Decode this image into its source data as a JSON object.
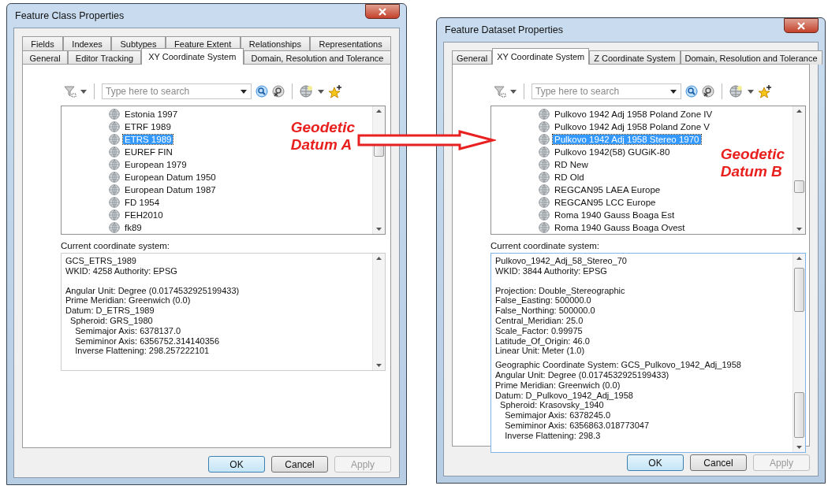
{
  "dialogs": [
    {
      "title": "Feature Class Properties",
      "tab_rows": [
        [
          {
            "label": "Fields",
            "selected": false
          },
          {
            "label": "Indexes",
            "selected": false
          },
          {
            "label": "Subtypes",
            "selected": false
          },
          {
            "label": "Feature Extent",
            "selected": false
          },
          {
            "label": "Relationships",
            "selected": false
          },
          {
            "label": "Representations",
            "selected": false
          }
        ],
        [
          {
            "label": "General",
            "selected": false
          },
          {
            "label": "Editor Tracking",
            "selected": false
          },
          {
            "label": "XY Coordinate System",
            "selected": true
          },
          {
            "label": "Domain, Resolution and Tolerance",
            "selected": false
          }
        ]
      ],
      "search": {
        "placeholder": "Type here to search"
      },
      "items": [
        {
          "label": "Estonia 1997",
          "selected": false
        },
        {
          "label": "ETRF 1989",
          "selected": false
        },
        {
          "label": "ETRS 1989",
          "selected": true
        },
        {
          "label": "EUREF FIN",
          "selected": false
        },
        {
          "label": "European 1979",
          "selected": false
        },
        {
          "label": "European Datum 1950",
          "selected": false
        },
        {
          "label": "European Datum 1987",
          "selected": false
        },
        {
          "label": "FD 1954",
          "selected": false
        },
        {
          "label": "FEH2010",
          "selected": false
        },
        {
          "label": "fk89",
          "selected": false
        }
      ],
      "annotation": [
        "Geodetic",
        "Datum A"
      ],
      "info_label": "Current coordinate system:",
      "info_blocks": [
        [
          "GCS_ETRS_1989",
          "WKID: 4258 Authority: EPSG"
        ],
        [
          "Angular Unit: Degree (0.0174532925199433)",
          "Prime Meridian: Greenwich (0.0)",
          "Datum: D_ETRS_1989",
          "  Spheroid: GRS_1980",
          "    Semimajor Axis: 6378137.0",
          "    Semiminor Axis: 6356752.314140356",
          "    Inverse Flattening: 298.257222101"
        ]
      ],
      "buttons": [
        {
          "label": "OK",
          "disabled": false
        },
        {
          "label": "Cancel",
          "disabled": false
        },
        {
          "label": "Apply",
          "disabled": true
        }
      ]
    },
    {
      "title": "Feature Dataset Properties",
      "tab_rows": [
        [
          {
            "label": "General",
            "selected": false
          },
          {
            "label": "XY Coordinate System",
            "selected": true
          },
          {
            "label": "Z Coordinate System",
            "selected": false
          },
          {
            "label": "Domain, Resolution and Tolerance",
            "selected": false
          }
        ]
      ],
      "search": {
        "placeholder": "Type here to search"
      },
      "items": [
        {
          "label": "Pulkovo 1942 Adj 1958 Poland Zone IV",
          "selected": false
        },
        {
          "label": "Pulkovo 1942 Adj 1958 Poland Zone V",
          "selected": false
        },
        {
          "label": "Pulkovo 1942 Adj 1958 Stereo 1970",
          "selected": true
        },
        {
          "label": "Pulkovo 1942(58) GUGiK-80",
          "selected": false
        },
        {
          "label": "RD New",
          "selected": false
        },
        {
          "label": "RD Old",
          "selected": false
        },
        {
          "label": "REGCAN95 LAEA Europe",
          "selected": false
        },
        {
          "label": "REGCAN95 LCC Europe",
          "selected": false
        },
        {
          "label": "Roma 1940 Gauss Boaga Est",
          "selected": false
        },
        {
          "label": "Roma 1940 Gauss Boaga Ovest",
          "selected": false
        }
      ],
      "annotation": [
        "Geodetic",
        "Datum B"
      ],
      "info_label": "Current coordinate system:",
      "info_blocks": [
        [
          "Pulkovo_1942_Adj_58_Stereo_70",
          "WKID: 3844 Authority: EPSG"
        ],
        [
          "Projection: Double_Stereographic",
          "False_Easting: 500000.0",
          "False_Northing: 500000.0",
          "Central_Meridian: 25.0",
          "Scale_Factor: 0.99975",
          "Latitude_Of_Origin: 46.0",
          "Linear Unit: Meter (1.0)"
        ],
        [
          "Geographic Coordinate System: GCS_Pulkovo_1942_Adj_1958",
          "Angular Unit: Degree (0.0174532925199433)",
          "Prime Meridian: Greenwich (0.0)",
          "Datum: D_Pulkovo_1942_Adj_1958",
          "  Spheroid: Krasovsky_1940",
          "    Semimajor Axis: 6378245.0",
          "    Semiminor Axis: 6356863.018773047",
          "    Inverse Flattening: 298.3"
        ]
      ],
      "buttons": [
        {
          "label": "OK",
          "disabled": false
        },
        {
          "label": "Cancel",
          "disabled": false
        },
        {
          "label": "Apply",
          "disabled": true
        }
      ]
    }
  ]
}
